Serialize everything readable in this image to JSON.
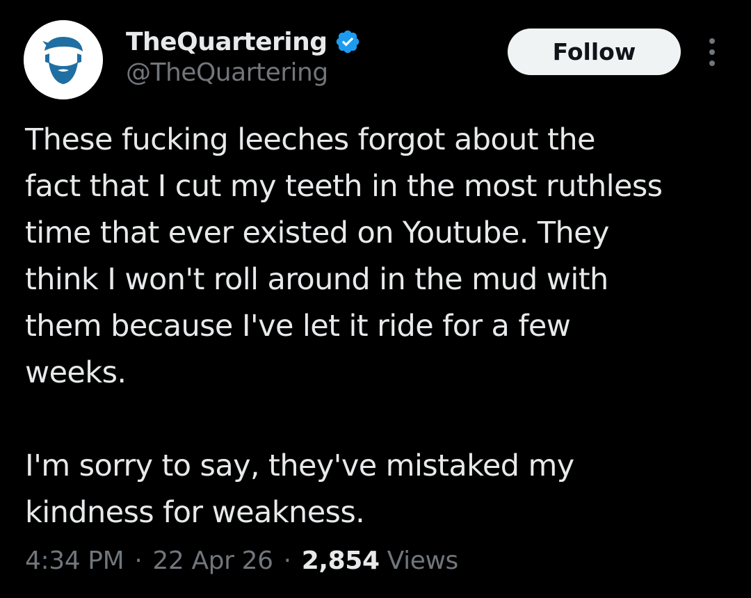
{
  "author": {
    "display_name": "TheQuartering",
    "handle": "@TheQuartering",
    "verified": true,
    "verified_color": "#1d9bf0",
    "avatar_icon": "bearded-man-logo-icon",
    "avatar_color": "#1f6fa3"
  },
  "actions": {
    "follow_label": "Follow",
    "more_icon": "more-vertical-icon"
  },
  "tweet": {
    "paragraphs": [
      "These fucking leeches forgot about the\nfact that I cut my teeth in the most ruthless\ntime that ever existed on Youtube.  They\nthink I won't roll around in the mud with\nthem because I've let it ride for a few\nweeks.",
      "I'm sorry to say, they've mistaked my\nkindness for weakness."
    ]
  },
  "meta": {
    "time": "4:34 PM",
    "separator": "·",
    "date": "22 Apr 26",
    "views_count": "2,854",
    "views_label": "Views"
  },
  "colors": {
    "background": "#000000",
    "primary_text": "#e7e9ea",
    "secondary_text": "#71767b",
    "follow_bg": "#eff3f4",
    "follow_text": "#0f1419"
  }
}
